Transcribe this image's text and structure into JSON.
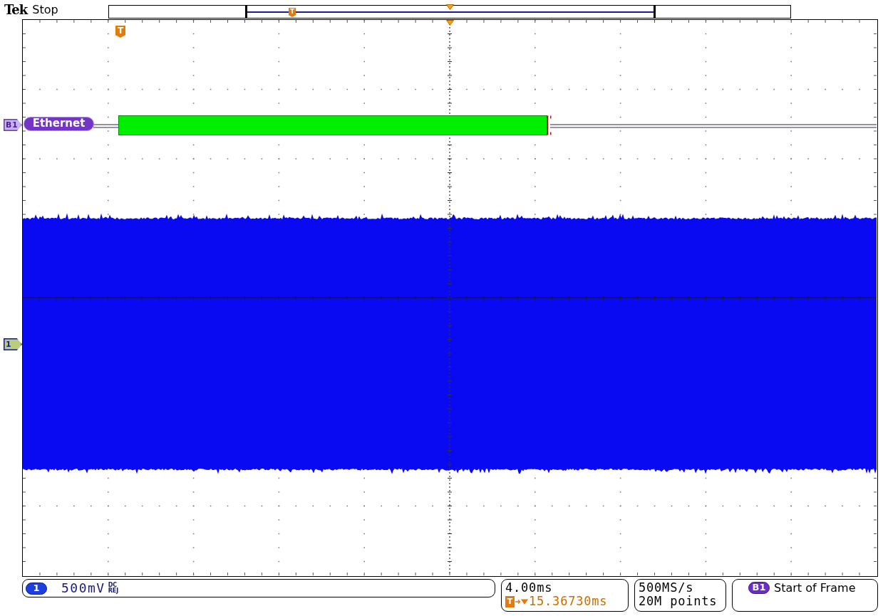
{
  "header": {
    "brand": "Tek",
    "acquisition_state": "Stop",
    "record_view": {
      "trigger_mark": "T"
    }
  },
  "graticule": {
    "trigger_mark": "T",
    "traces": [
      {
        "kind": "bus",
        "marker": "B1",
        "label": "Ethernet",
        "color": "#7434c8"
      },
      {
        "kind": "analog",
        "marker": "1",
        "color": "#0a0af2"
      }
    ]
  },
  "readouts": {
    "channel": {
      "marker": "1",
      "scale": "500mV",
      "coupling": "DC REJ"
    },
    "timebase": {
      "scale": "4.00ms",
      "trigger_mark": "T",
      "delay": "15.36730ms"
    },
    "acquisition": {
      "sample_rate": "500MS/s",
      "record_length": "20M points"
    },
    "trigger": {
      "source": "B1",
      "type": "Start of Frame"
    }
  }
}
